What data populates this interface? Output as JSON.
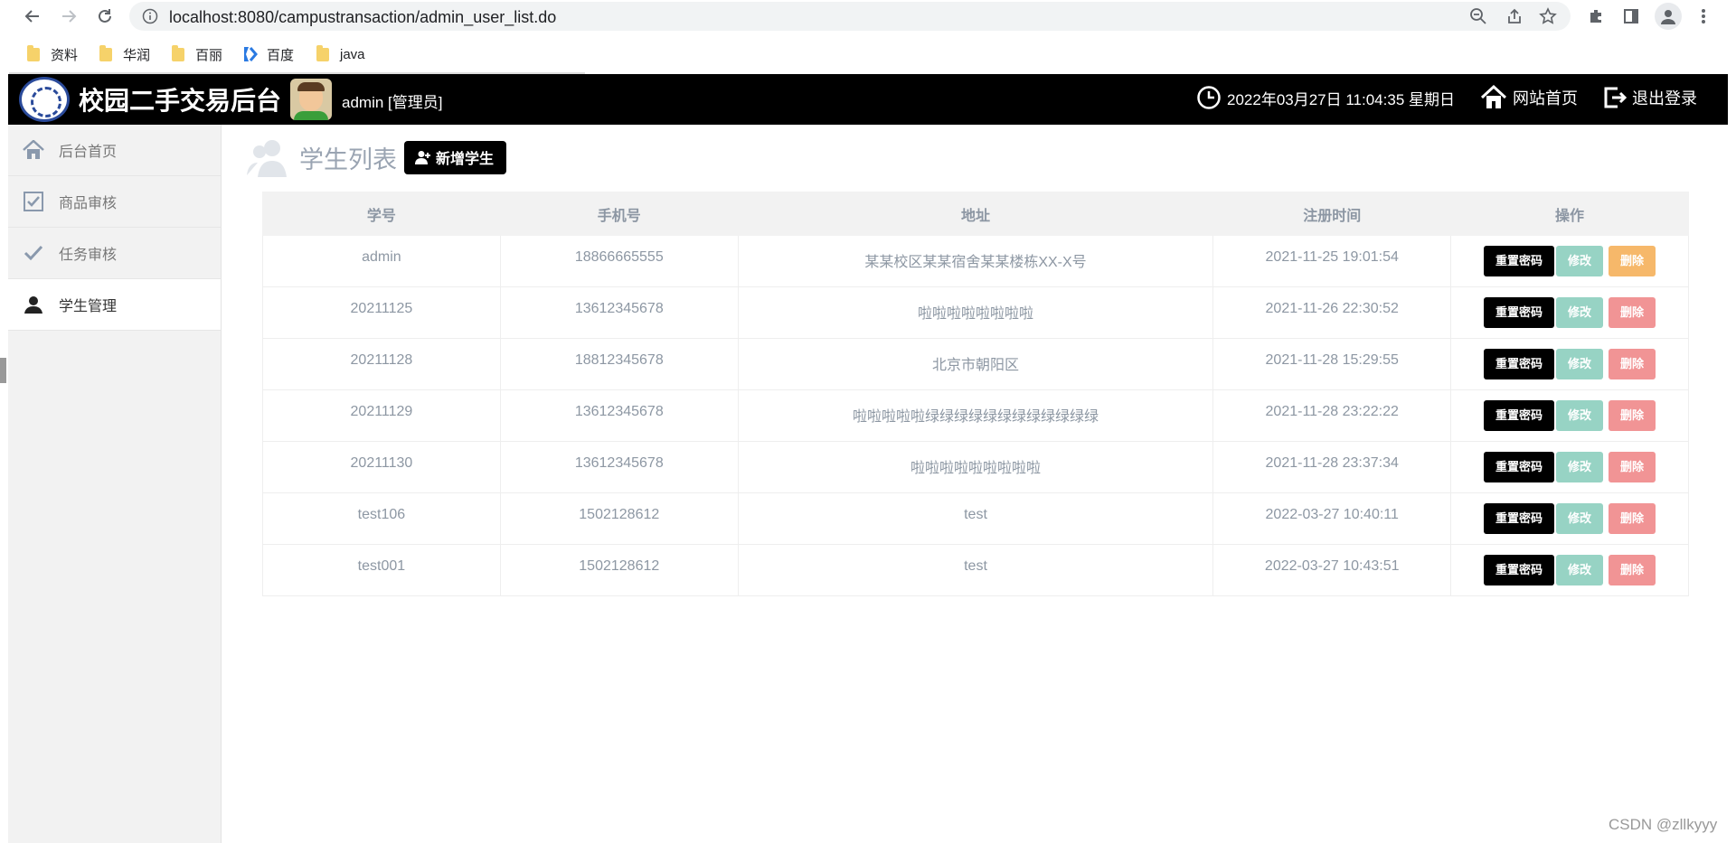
{
  "browser": {
    "url": "localhost:8080/campustransaction/admin_user_list.do",
    "bookmarks": [
      {
        "label": "资料",
        "icon": "folder-icon"
      },
      {
        "label": "华润",
        "icon": "folder-icon"
      },
      {
        "label": "百丽",
        "icon": "folder-icon"
      },
      {
        "label": "百度",
        "icon": "baidu-icon"
      },
      {
        "label": "java",
        "icon": "folder-icon"
      }
    ]
  },
  "header": {
    "title": "校园二手交易后台",
    "user": "admin [管理员]",
    "datetime": "2022年03月27日 11:04:35 星期日",
    "home_link": "网站首页",
    "logout_link": "退出登录"
  },
  "sidebar": {
    "items": [
      {
        "label": "后台首页",
        "icon": "home-icon"
      },
      {
        "label": "商品审核",
        "icon": "checkbox-icon"
      },
      {
        "label": "任务审核",
        "icon": "check-icon"
      },
      {
        "label": "学生管理",
        "icon": "user-icon",
        "active": true
      }
    ]
  },
  "main": {
    "title": "学生列表",
    "add_button": "新增学生",
    "columns": [
      "学号",
      "手机号",
      "地址",
      "注册时间",
      "操作"
    ],
    "actions": {
      "reset": "重置密码",
      "edit": "修改",
      "delete": "删除"
    },
    "rows": [
      {
        "id": "admin",
        "phone": "18866665555",
        "address": "某某校区某某宿舍某某楼栋XX-X号",
        "time": "2021-11-25 19:01:54"
      },
      {
        "id": "20211125",
        "phone": "13612345678",
        "address": "啦啦啦啦啦啦啦啦",
        "time": "2021-11-26 22:30:52"
      },
      {
        "id": "20211128",
        "phone": "18812345678",
        "address": "北京市朝阳区",
        "time": "2021-11-28 15:29:55"
      },
      {
        "id": "20211129",
        "phone": "13612345678",
        "address": "啦啦啦啦啦绿绿绿绿绿绿绿绿绿绿绿绿",
        "time": "2021-11-28 23:22:22"
      },
      {
        "id": "20211130",
        "phone": "13612345678",
        "address": "啦啦啦啦啦啦啦啦啦",
        "time": "2021-11-28 23:37:34"
      },
      {
        "id": "test106",
        "phone": "1502128612",
        "address": "test",
        "time": "2022-03-27 10:40:11"
      },
      {
        "id": "test001",
        "phone": "1502128612",
        "address": "test",
        "time": "2022-03-27 10:43:51"
      }
    ]
  },
  "watermark": "CSDN @zllkyyy",
  "colors": {
    "header_bg": "#000000",
    "sidebar_bg": "#f2f2f2",
    "edit_button": "#97d3c4",
    "delete_button": "#f19495",
    "delete_button_admin": "#f6b86a"
  }
}
